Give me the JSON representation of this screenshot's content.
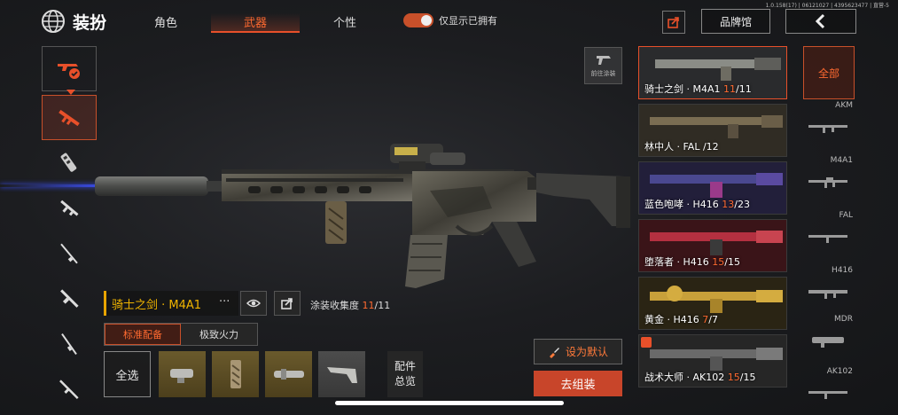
{
  "status": {
    "build_info": "1.0.158(17) | 06121027 | 4395623477 | 直营-5"
  },
  "header": {
    "title": "装扮",
    "tabs": [
      {
        "label": "角色",
        "active": false
      },
      {
        "label": "武器",
        "active": true
      },
      {
        "label": "个性",
        "active": false
      }
    ],
    "owned_toggle": {
      "label": "仅显示已拥有",
      "on": true
    },
    "brand_button": "品牌馆"
  },
  "weapon": {
    "name": "骑士之剑 · M4A1",
    "more": "···",
    "collection_label": "涂装收集度",
    "collection_current": "11",
    "collection_total": "/11",
    "goto_skin_label": "前往涂装"
  },
  "loadout": {
    "tabs": [
      {
        "label": "标准配备",
        "active": true
      },
      {
        "label": "极致火力",
        "active": false
      }
    ],
    "select_all": "全选",
    "overview_line1": "配件",
    "overview_line2": "总览"
  },
  "actions": {
    "set_default": "设为默认",
    "go_build": "去组装"
  },
  "skins": [
    {
      "name": "骑士之剑 · M4A1",
      "current": "11",
      "total": "/11",
      "selected": true,
      "color": "#55585c"
    },
    {
      "name": "林中人 · FAL",
      "current": "",
      "total": "/12",
      "selected": false,
      "color": "#5a5140"
    },
    {
      "name": "蓝色咆哮 · H416",
      "current": "13",
      "total": "/23",
      "selected": false,
      "color": "#3c3a6e"
    },
    {
      "name": "堕落者 · H416",
      "current": "15",
      "total": "/15",
      "selected": false,
      "color": "#7a2630"
    },
    {
      "name": "黄金 · H416",
      "current": "7",
      "total": "/7",
      "selected": false,
      "color": "#6b5a22"
    },
    {
      "name": "战术大师 · AK102",
      "current": "15",
      "total": "/15",
      "selected": false,
      "color": "#4a4a4a"
    }
  ],
  "filters": {
    "all_label": "全部",
    "items": [
      {
        "name": "AKM"
      },
      {
        "name": "M4A1"
      },
      {
        "name": "FAL"
      },
      {
        "name": "H416"
      },
      {
        "name": "MDR"
      },
      {
        "name": "AK102"
      }
    ]
  },
  "colors": {
    "accent": "#e8502a",
    "gold": "#f0b400",
    "laser": "#3c50ff"
  }
}
